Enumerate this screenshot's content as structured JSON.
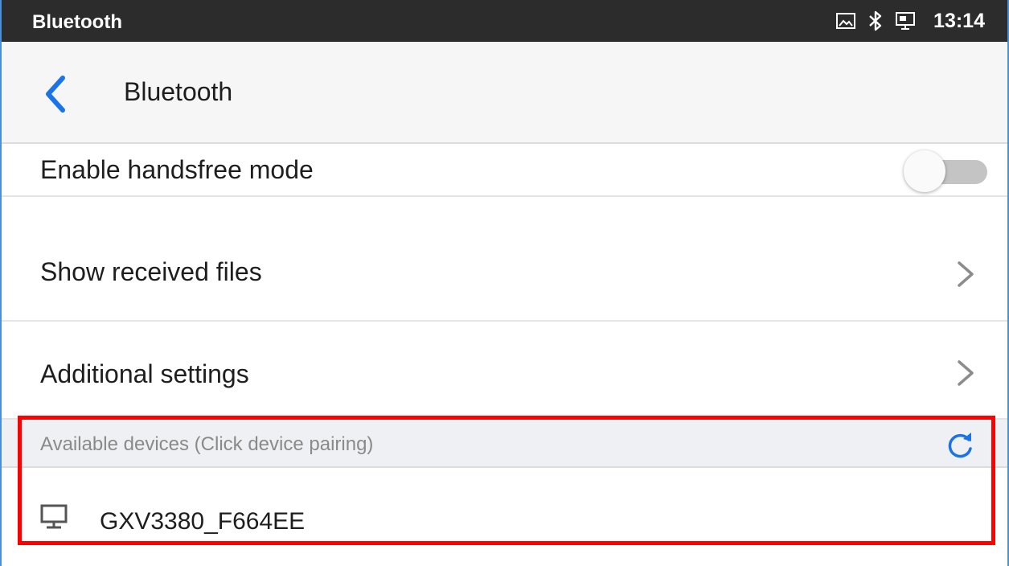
{
  "status_bar": {
    "app_label": "Bluetooth",
    "icons": [
      "picture-icon",
      "bluetooth-icon",
      "screen-share-icon"
    ],
    "time": "13:14"
  },
  "action_bar": {
    "back_icon": "chevron-left-icon",
    "title": "Bluetooth"
  },
  "settings": {
    "handsfree": {
      "label": "Enable handsfree mode",
      "enabled": false
    },
    "received_files": {
      "label": "Show received files"
    },
    "additional": {
      "label": "Additional settings"
    }
  },
  "available_devices": {
    "header": "Available devices (Click device pairing)",
    "refresh_icon": "refresh-icon",
    "devices": [
      {
        "name": "GXV3380_F664EE",
        "icon": "computer-icon"
      }
    ]
  },
  "colors": {
    "status_bar_bg": "#2c2c2c",
    "accent": "#1a73e8",
    "highlight": "#ff0000"
  }
}
